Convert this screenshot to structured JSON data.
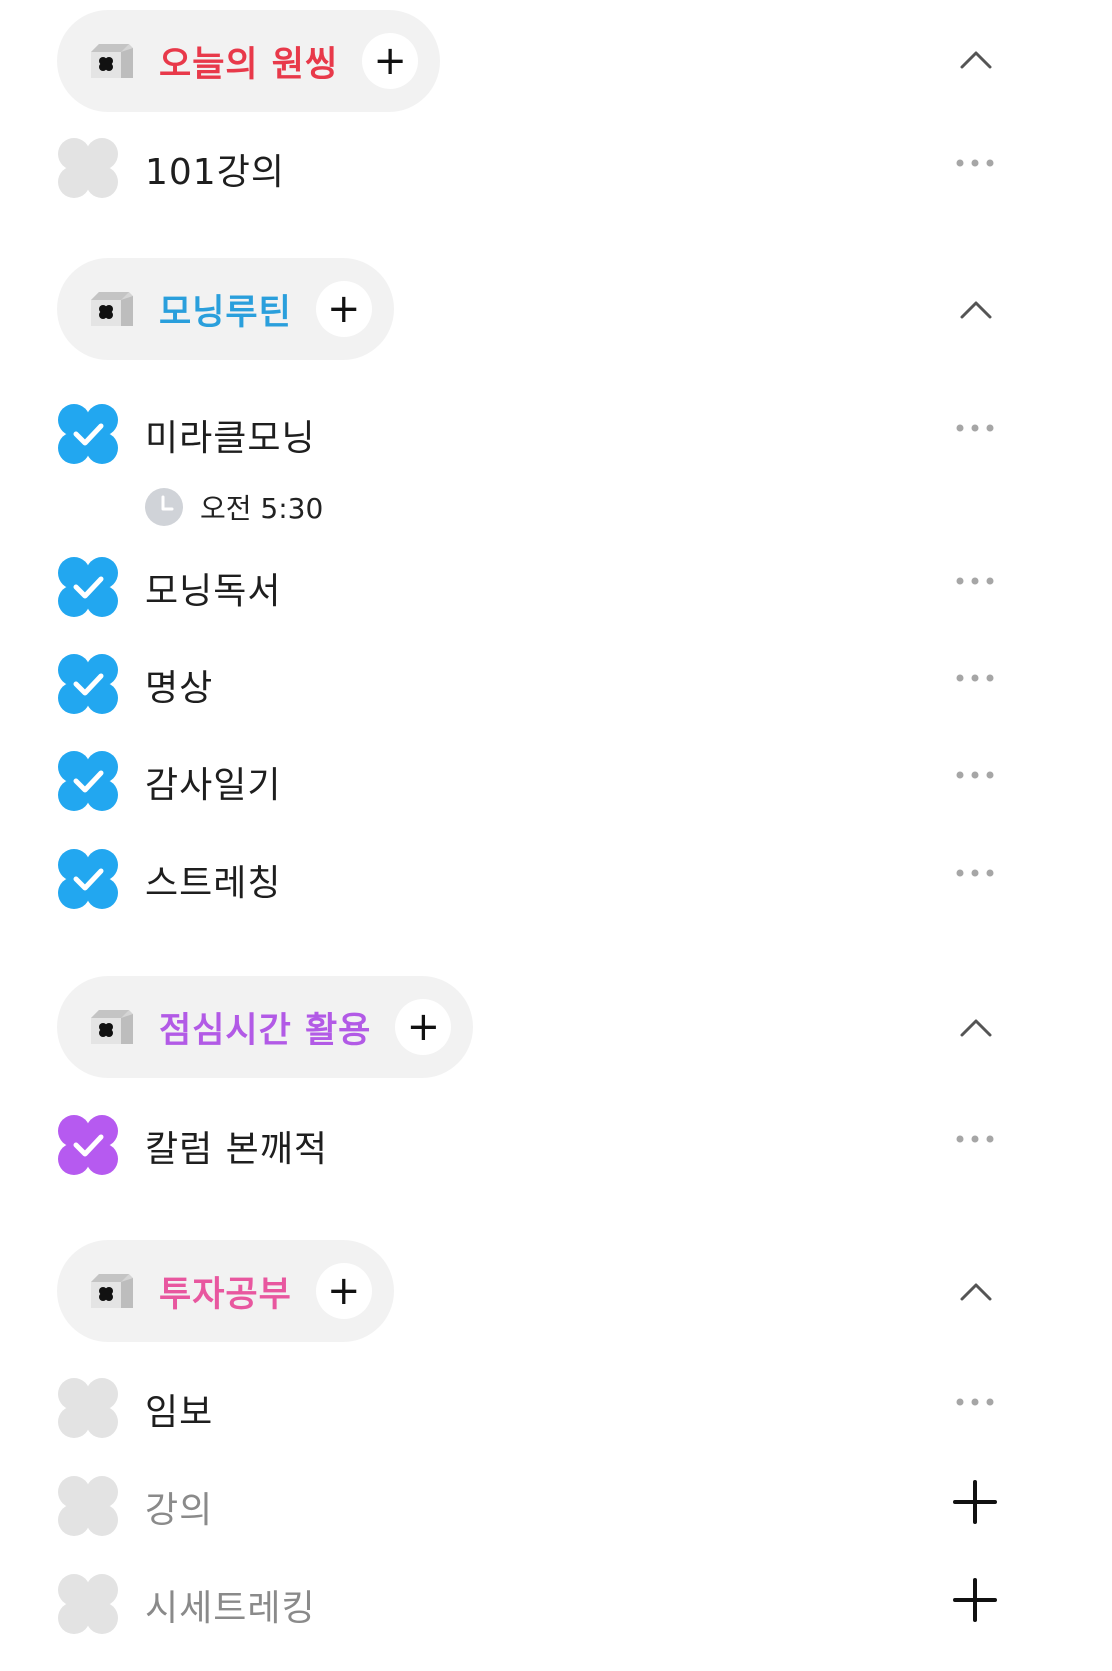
{
  "colors": {
    "pill_bg": "#f2f2f2",
    "checked_blue": "#22a7f0",
    "checked_purple": "#b65af0",
    "unchecked": "#e3e3e3",
    "group1_title": "#e8394a",
    "group2_title": "#2a9fdc",
    "group3_title": "#b25ae6",
    "group4_title": "#e8579f"
  },
  "groups": [
    {
      "title": "오늘의 원씽",
      "items": [
        {
          "label": "101강의",
          "checked": false
        }
      ]
    },
    {
      "title": "모닝루틴",
      "items": [
        {
          "label": "미라클모닝",
          "checked": true,
          "time": "오전 5:30"
        },
        {
          "label": "모닝독서",
          "checked": true
        },
        {
          "label": "명상",
          "checked": true
        },
        {
          "label": "감사일기",
          "checked": true
        },
        {
          "label": "스트레칭",
          "checked": true
        }
      ]
    },
    {
      "title": "점심시간 활용",
      "items": [
        {
          "label": "칼럼 본깨적",
          "checked": true
        }
      ]
    },
    {
      "title": "투자공부",
      "items": [
        {
          "label": "임보",
          "checked": false
        },
        {
          "label": "강의",
          "checked": false,
          "placeholder": true
        },
        {
          "label": "시세트레킹",
          "checked": false,
          "placeholder": true
        }
      ]
    }
  ],
  "icons": {
    "group_icon": "folder-icon",
    "add": "plus-icon",
    "collapse": "chevron-up-icon",
    "more": "more-icon",
    "time": "clock-icon"
  }
}
